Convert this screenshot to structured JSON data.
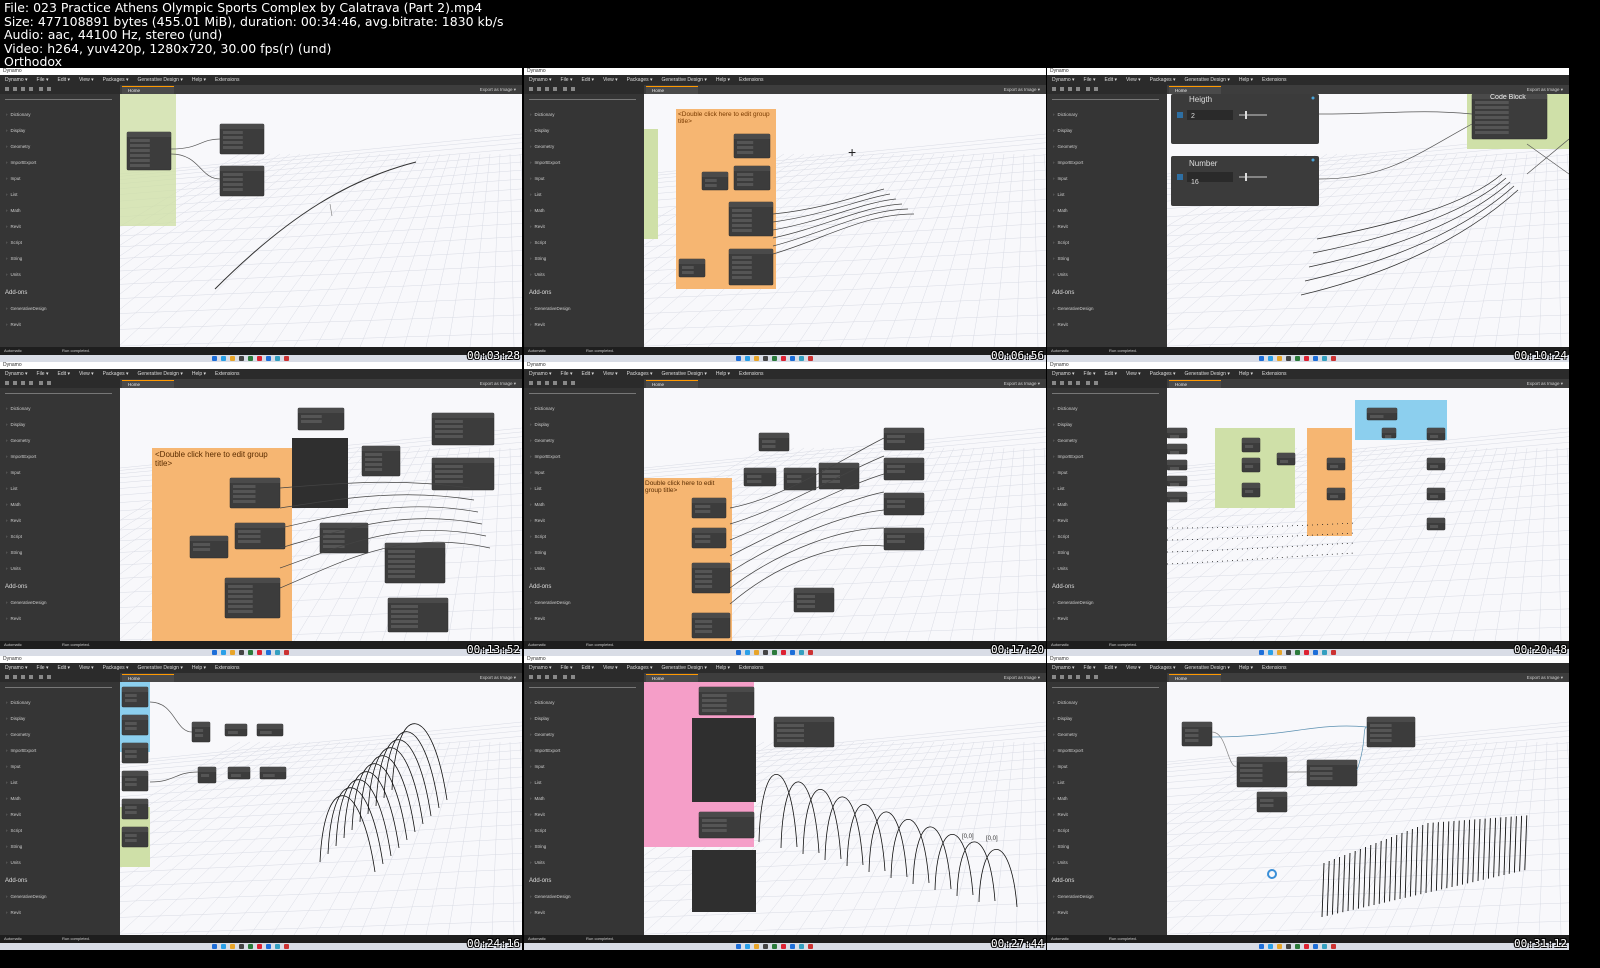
{
  "file_info": {
    "line1": "File: 023 Practice  Athens Olympic Sports Complex by Calatrava (Part 2).mp4",
    "line2": "Size: 477108891 bytes (455.01 MiB), duration: 00:34:46, avg.bitrate: 1830 kb/s",
    "line3": "Audio: aac, 44100 Hz, stereo (und)",
    "line4": "Video: h264, yuv420p, 1280x720, 30.00 fps(r) (und)",
    "line5": "Orthodox"
  },
  "app": {
    "window_title": "Dynamo",
    "menu": [
      "Dynamo ▾",
      "File ▾",
      "Edit ▾",
      "View ▾",
      "Packages ▾",
      "Generative Design ▾",
      "Help ▾",
      "Extensions"
    ],
    "tab": "Home",
    "export_label": "Export as Image ▾",
    "library": [
      "Dictionary",
      "Display",
      "Geometry",
      "ImportExport",
      "Input",
      "List",
      "Math",
      "Revit",
      "Script",
      "String",
      "Units"
    ],
    "addons_label": "Add-ons",
    "addons": [
      "GenerativeDesign",
      "Revit"
    ],
    "run_mode": "Automatic",
    "run_status": "Run completed."
  },
  "frames": [
    {
      "timestamp": "00:03:28"
    },
    {
      "timestamp": "00:06:56"
    },
    {
      "timestamp": "00:10:24"
    },
    {
      "timestamp": "00:13:52"
    },
    {
      "timestamp": "00:17:20"
    },
    {
      "timestamp": "00:20:48"
    },
    {
      "timestamp": "00:24:16"
    },
    {
      "timestamp": "00:27:44"
    },
    {
      "timestamp": "00:31:12"
    }
  ],
  "canvas_text": {
    "group_title": "<Double click here to edit group title>",
    "group_title_short": "Double click here to edit group title>",
    "heigth_label": "Heigth",
    "heigth_value": "2",
    "number_label": "Number",
    "number_value": "16",
    "code_block": "Code Block",
    "left_arc": "Left_Arc",
    "right_arc": "Right_Arc",
    "top": "Top",
    "curve_point": "Curve.PointAtParameter",
    "coord_a": "[0,0]",
    "coord_b": "[0,0]"
  }
}
